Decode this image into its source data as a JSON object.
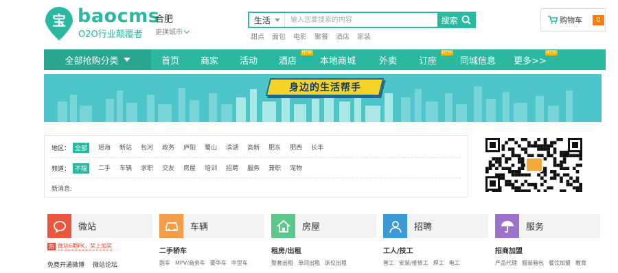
{
  "header": {
    "logo_char": "宝",
    "logo_title": "baocms",
    "logo_sub": "O2O行业颠覆者",
    "city": "合肥",
    "city_switch": "更换城市",
    "search_type": "生活",
    "search_placeholder": "输入您要搜索的内容",
    "search_button": "搜索",
    "hot_words": [
      "甜点",
      "面包",
      "电影",
      "聚餐",
      "酒店",
      "家装"
    ],
    "cart_label": "购物车",
    "cart_count": "0"
  },
  "nav": {
    "category_label": "全部抢购分类",
    "items": [
      {
        "label": "首页",
        "new": false
      },
      {
        "label": "商家",
        "new": false
      },
      {
        "label": "活动",
        "new": false
      },
      {
        "label": "酒店",
        "new": true
      },
      {
        "label": "本地商城",
        "new": false
      },
      {
        "label": "外卖",
        "new": false
      },
      {
        "label": "订座",
        "new": true
      },
      {
        "label": "同城信息",
        "new": false
      },
      {
        "label": "更多>>",
        "new": true
      }
    ],
    "new_badge": "NEW"
  },
  "banner": {
    "text": "身边的生活帮手"
  },
  "filter": {
    "region_label": "地区：",
    "regions": [
      "全部",
      "瑶海",
      "新站",
      "包河",
      "政务",
      "庐阳",
      "蜀山",
      "滨湖",
      "高新",
      "肥东",
      "肥西",
      "长丰"
    ],
    "channel_label": "频道：",
    "channels": [
      "不限",
      "二手",
      "车辆",
      "求职",
      "交友",
      "房屋",
      "培训",
      "招聘",
      "服务",
      "兼职",
      "宠物"
    ],
    "news_label": "新消息:"
  },
  "categories": [
    {
      "name": "微站",
      "color": "#e9573f",
      "icon": "chat-bubble-icon"
    },
    {
      "name": "车辆",
      "color": "#f39c4a",
      "icon": "car-icon"
    },
    {
      "name": "房屋",
      "color": "#5cc98a",
      "icon": "house-icon"
    },
    {
      "name": "招聘",
      "color": "#3c9ad9",
      "icon": "person-icon"
    },
    {
      "name": "服务",
      "color": "#9b73c9",
      "icon": "umbrella-icon"
    }
  ],
  "weizhan": {
    "promo_tag": "热",
    "promo_text": "微站6期PK，奖上加奖",
    "links": [
      "免费开通微博",
      "微站论坛"
    ]
  },
  "cheliang": {
    "sub": "二手轿车",
    "links": [
      "跑车",
      "MPV/商务车",
      "豪华车",
      "中型车"
    ]
  },
  "fangwu": {
    "sub": "租房/出租",
    "links": [
      "整套出租",
      "单间出租",
      "床位出租"
    ]
  },
  "zhaopin": {
    "sub": "工人/技工",
    "links": [
      "普工",
      "安装/维修工",
      "焊工",
      "电工"
    ]
  },
  "fuwu": {
    "sub": "招商加盟",
    "links": [
      "产品代理",
      "服装箱包",
      "餐饮加盟",
      "教育"
    ]
  }
}
